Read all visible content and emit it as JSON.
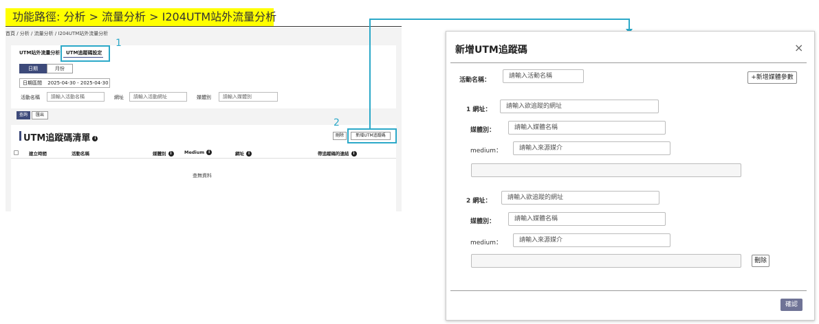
{
  "banner": {
    "text": "功能路徑: 分析 > 流量分析 > I204UTM站外流量分析"
  },
  "left": {
    "breadcrumb": "首頁 / 分析 / 流量分析 / I204UTM站外流量分析",
    "tabs": [
      "UTM站外流量分析",
      "UTM追蹤碼設定"
    ],
    "segments": {
      "day": "日期",
      "month": "月份"
    },
    "date_range_label": "日期區間",
    "date_range_value": "2025-04-30 - 2025-04-30",
    "filters": {
      "activity_label": "活動名稱",
      "activity_placeholder": "請輸入活動名稱",
      "url_label": "網址",
      "url_placeholder": "請輸入活動網址",
      "medium_label": "媒體別",
      "medium_placeholder": "請輸入媒體別"
    },
    "query_button": "查詢",
    "export_button": "匯出",
    "list_title": "UTM追蹤碼清單",
    "delete_button": "刪除",
    "add_button": "新增UTM追蹤碼",
    "columns": [
      "建立時間",
      "活動名稱",
      "媒體別",
      "Medium",
      "網址",
      "帶追蹤碼的連結"
    ],
    "empty_text": "查無資料",
    "callout_1": "1",
    "callout_2": "2"
  },
  "modal": {
    "title": "新增UTM追蹤碼",
    "close_icon": "×",
    "activity_label": "活動名稱：",
    "activity_placeholder": "請輸入活動名稱",
    "add_media_button": "+新增媒體參數",
    "entries": [
      {
        "url_label": "1 網址：",
        "url_placeholder": "請輸入欲追蹤的網址",
        "media_label": "媒體別：",
        "media_placeholder": "請輸入媒體名稱",
        "medium_label": "medium：",
        "medium_placeholder": "請輸入來源媒介"
      },
      {
        "url_label": "2 網址：",
        "url_placeholder": "請輸入欲追蹤的網址",
        "media_label": "媒體別：",
        "media_placeholder": "請輸入媒體名稱",
        "medium_label": "medium：",
        "medium_placeholder": "請輸入來源媒介"
      }
    ],
    "delete_button": "刪除",
    "confirm_button": "確認"
  },
  "colors": {
    "accent": "#2aa8c8",
    "primary": "#3d4a7a",
    "banner": "#ffff00"
  }
}
